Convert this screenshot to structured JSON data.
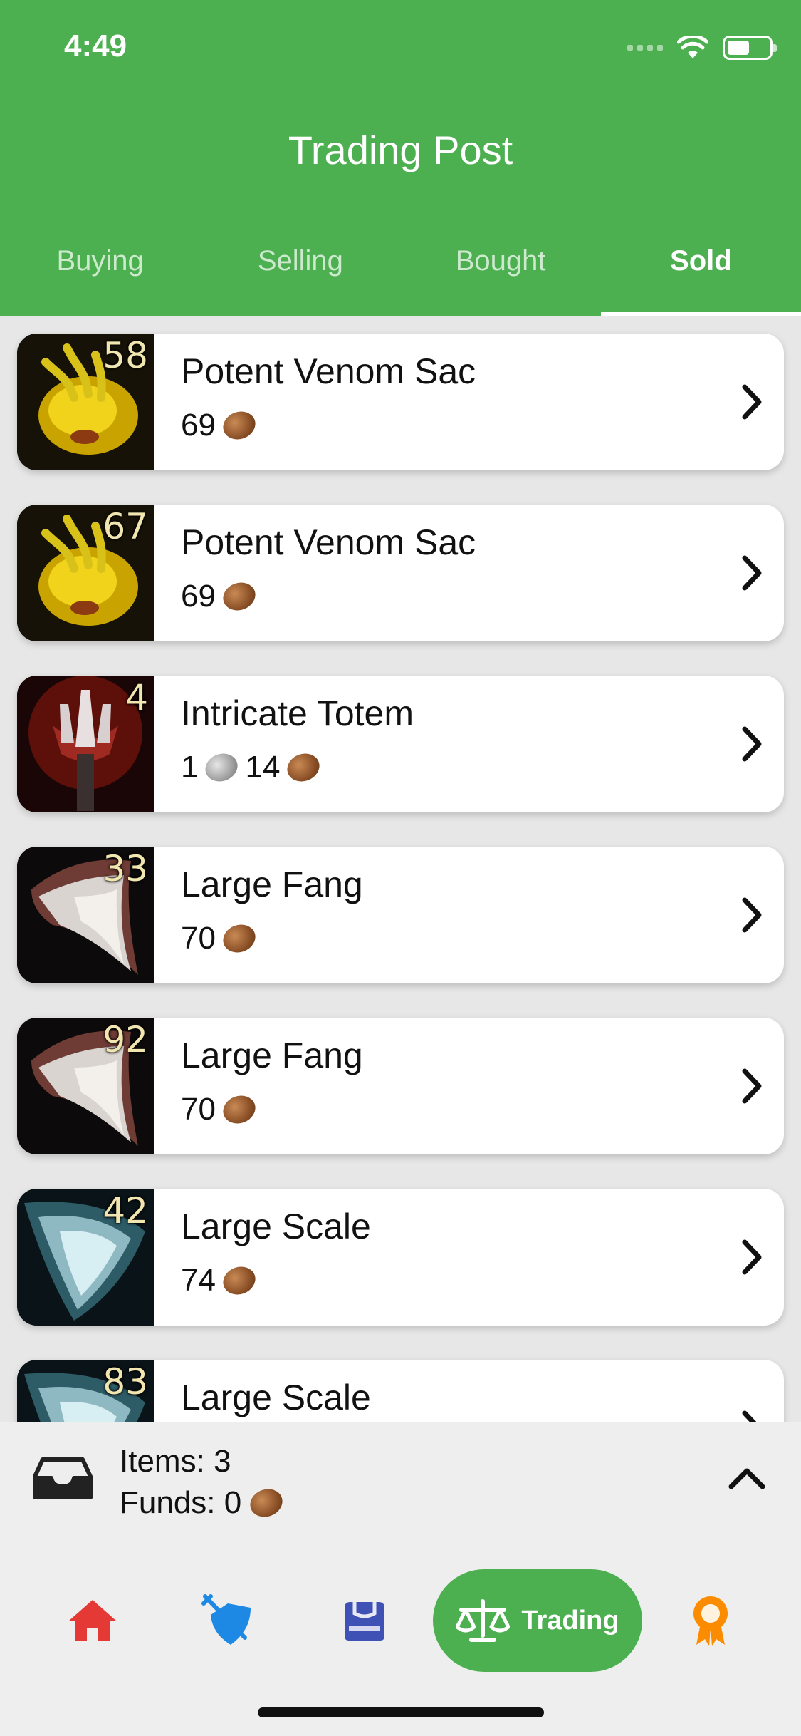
{
  "status_bar": {
    "time": "4:49"
  },
  "header": {
    "title": "Trading Post",
    "tabs": [
      {
        "label": "Buying",
        "active": false
      },
      {
        "label": "Selling",
        "active": false
      },
      {
        "label": "Bought",
        "active": false
      },
      {
        "label": "Sold",
        "active": true
      }
    ]
  },
  "items": [
    {
      "name": "Potent Venom Sac",
      "count": "58",
      "icon": "venom-sac-icon",
      "price": {
        "silver": "",
        "copper": "69"
      }
    },
    {
      "name": "Potent Venom Sac",
      "count": "67",
      "icon": "venom-sac-icon",
      "price": {
        "silver": "",
        "copper": "69"
      }
    },
    {
      "name": "Intricate Totem",
      "count": "4",
      "icon": "totem-icon",
      "price": {
        "silver": "1",
        "copper": "14"
      }
    },
    {
      "name": "Large Fang",
      "count": "33",
      "icon": "fang-icon",
      "price": {
        "silver": "",
        "copper": "70"
      }
    },
    {
      "name": "Large Fang",
      "count": "92",
      "icon": "fang-icon",
      "price": {
        "silver": "",
        "copper": "70"
      }
    },
    {
      "name": "Large Scale",
      "count": "42",
      "icon": "scale-icon",
      "price": {
        "silver": "",
        "copper": "74"
      }
    },
    {
      "name": "Large Scale",
      "count": "83",
      "icon": "scale-icon",
      "price": {
        "silver": "",
        "copper": ""
      }
    }
  ],
  "summary": {
    "items_text": "Items: 3",
    "funds_label": "Funds: 0"
  },
  "nav": {
    "items": [
      {
        "icon": "home-icon",
        "color": "#e53935"
      },
      {
        "icon": "sword-shield-icon",
        "color": "#1e88e5"
      },
      {
        "icon": "bag-icon",
        "color": "#3f51b5"
      },
      {
        "icon": "scale-balance-icon",
        "label": "Trading",
        "active": true
      },
      {
        "icon": "award-icon",
        "color": "#fb8c00"
      }
    ]
  },
  "colors": {
    "primary": "#4caf50",
    "copper": "#8a4f26",
    "silver": "#9e9e9e"
  }
}
